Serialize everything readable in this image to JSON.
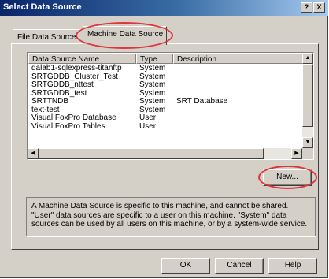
{
  "window": {
    "title": "Select Data Source",
    "help_button": "?",
    "close_button": "X"
  },
  "tabs": [
    {
      "label": "File Data Source",
      "selected": false
    },
    {
      "label": "Machine Data Source",
      "selected": true
    }
  ],
  "list": {
    "columns": [
      "Data Source Name",
      "Type",
      "Description"
    ],
    "rows": [
      {
        "name": "qalab1-sqlexpress-titanftp",
        "type": "System",
        "description": ""
      },
      {
        "name": "SRTGDDB_Cluster_Test",
        "type": "System",
        "description": ""
      },
      {
        "name": "SRTGDDB_nttest",
        "type": "System",
        "description": ""
      },
      {
        "name": "SRTGDDB_test",
        "type": "System",
        "description": ""
      },
      {
        "name": "SRTTNDB",
        "type": "System",
        "description": "SRT Database"
      },
      {
        "name": "text-test",
        "type": "System",
        "description": ""
      },
      {
        "name": "Visual FoxPro Database",
        "type": "User",
        "description": ""
      },
      {
        "name": "Visual FoxPro Tables",
        "type": "User",
        "description": ""
      }
    ]
  },
  "new_button": "New...",
  "info_text": "A Machine Data Source is specific to this machine, and cannot be shared. \"User\" data sources are specific to a user on this machine. \"System\" data sources can be used by all users on this machine, or by a system-wide service.",
  "buttons": {
    "ok": "OK",
    "cancel": "Cancel",
    "help": "Help"
  },
  "annotation_color": "#e0343a"
}
